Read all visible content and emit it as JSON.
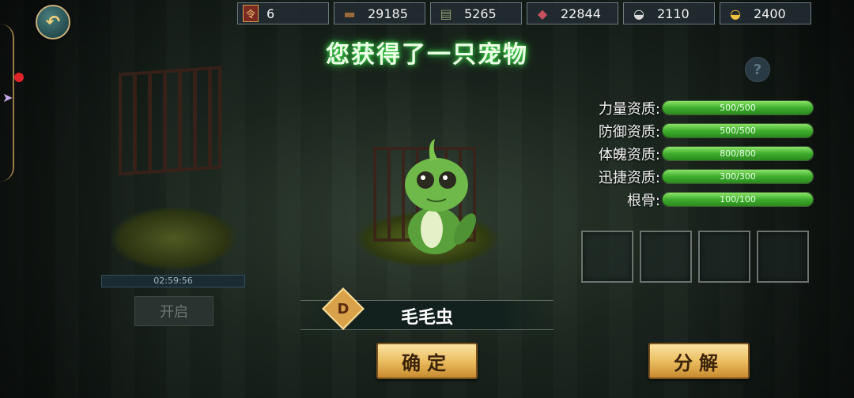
{
  "resources": [
    {
      "icon": "token-icon",
      "value": "6"
    },
    {
      "icon": "wood-icon",
      "value": "29185"
    },
    {
      "icon": "cloth-icon",
      "value": "5265"
    },
    {
      "icon": "meat-icon",
      "value": "22844"
    },
    {
      "icon": "silver-ingot-icon",
      "value": "2110"
    },
    {
      "icon": "gold-ingot-icon",
      "value": "2400"
    }
  ],
  "title": "您获得了一只宠物",
  "help": "?",
  "left_cage": {
    "timer": "02:59:56",
    "open_label": "开启"
  },
  "pet": {
    "grade": "D",
    "name": "毛毛虫"
  },
  "stats": [
    {
      "label": "力量资质:",
      "current": 500,
      "max": 500,
      "text": "500/500"
    },
    {
      "label": "防御资质:",
      "current": 500,
      "max": 500,
      "text": "500/500"
    },
    {
      "label": "体魄资质:",
      "current": 800,
      "max": 800,
      "text": "800/800"
    },
    {
      "label": "迅捷资质:",
      "current": 300,
      "max": 300,
      "text": "300/300"
    },
    {
      "label": "根骨:",
      "current": 100,
      "max": 100,
      "text": "100/100"
    }
  ],
  "buttons": {
    "confirm": "确定",
    "decompose": "分解"
  },
  "colors": {
    "title_glow": "#3ddc4a",
    "stat_fill": "#3fae2d",
    "button_gold": "#e9ba5c"
  }
}
